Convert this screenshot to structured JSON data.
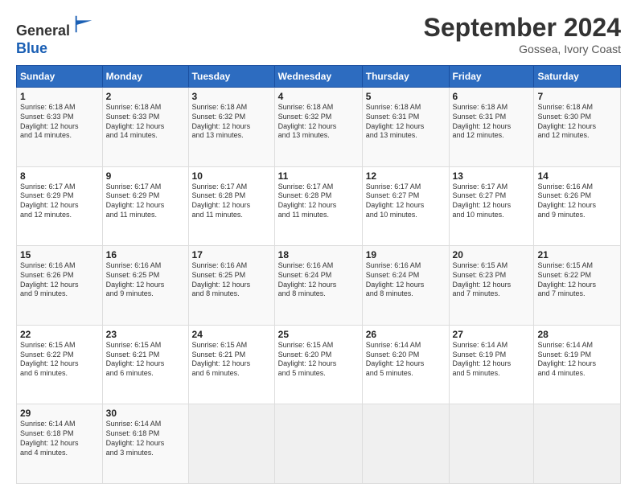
{
  "logo": {
    "general": "General",
    "blue": "Blue"
  },
  "header": {
    "month": "September 2024",
    "location": "Gossea, Ivory Coast"
  },
  "days_of_week": [
    "Sunday",
    "Monday",
    "Tuesday",
    "Wednesday",
    "Thursday",
    "Friday",
    "Saturday"
  ],
  "weeks": [
    [
      {
        "day": 1,
        "sunrise": "6:18 AM",
        "sunset": "6:33 PM",
        "daylight": "12 hours and 14 minutes."
      },
      {
        "day": 2,
        "sunrise": "6:18 AM",
        "sunset": "6:33 PM",
        "daylight": "12 hours and 14 minutes."
      },
      {
        "day": 3,
        "sunrise": "6:18 AM",
        "sunset": "6:32 PM",
        "daylight": "12 hours and 13 minutes."
      },
      {
        "day": 4,
        "sunrise": "6:18 AM",
        "sunset": "6:32 PM",
        "daylight": "12 hours and 13 minutes."
      },
      {
        "day": 5,
        "sunrise": "6:18 AM",
        "sunset": "6:31 PM",
        "daylight": "12 hours and 13 minutes."
      },
      {
        "day": 6,
        "sunrise": "6:18 AM",
        "sunset": "6:31 PM",
        "daylight": "12 hours and 12 minutes."
      },
      {
        "day": 7,
        "sunrise": "6:18 AM",
        "sunset": "6:30 PM",
        "daylight": "12 hours and 12 minutes."
      }
    ],
    [
      {
        "day": 8,
        "sunrise": "6:17 AM",
        "sunset": "6:29 PM",
        "daylight": "12 hours and 12 minutes."
      },
      {
        "day": 9,
        "sunrise": "6:17 AM",
        "sunset": "6:29 PM",
        "daylight": "12 hours and 11 minutes."
      },
      {
        "day": 10,
        "sunrise": "6:17 AM",
        "sunset": "6:28 PM",
        "daylight": "12 hours and 11 minutes."
      },
      {
        "day": 11,
        "sunrise": "6:17 AM",
        "sunset": "6:28 PM",
        "daylight": "12 hours and 11 minutes."
      },
      {
        "day": 12,
        "sunrise": "6:17 AM",
        "sunset": "6:27 PM",
        "daylight": "12 hours and 10 minutes."
      },
      {
        "day": 13,
        "sunrise": "6:17 AM",
        "sunset": "6:27 PM",
        "daylight": "12 hours and 10 minutes."
      },
      {
        "day": 14,
        "sunrise": "6:16 AM",
        "sunset": "6:26 PM",
        "daylight": "12 hours and 9 minutes."
      }
    ],
    [
      {
        "day": 15,
        "sunrise": "6:16 AM",
        "sunset": "6:26 PM",
        "daylight": "12 hours and 9 minutes."
      },
      {
        "day": 16,
        "sunrise": "6:16 AM",
        "sunset": "6:25 PM",
        "daylight": "12 hours and 9 minutes."
      },
      {
        "day": 17,
        "sunrise": "6:16 AM",
        "sunset": "6:25 PM",
        "daylight": "12 hours and 8 minutes."
      },
      {
        "day": 18,
        "sunrise": "6:16 AM",
        "sunset": "6:24 PM",
        "daylight": "12 hours and 8 minutes."
      },
      {
        "day": 19,
        "sunrise": "6:16 AM",
        "sunset": "6:24 PM",
        "daylight": "12 hours and 8 minutes."
      },
      {
        "day": 20,
        "sunrise": "6:15 AM",
        "sunset": "6:23 PM",
        "daylight": "12 hours and 7 minutes."
      },
      {
        "day": 21,
        "sunrise": "6:15 AM",
        "sunset": "6:22 PM",
        "daylight": "12 hours and 7 minutes."
      }
    ],
    [
      {
        "day": 22,
        "sunrise": "6:15 AM",
        "sunset": "6:22 PM",
        "daylight": "12 hours and 6 minutes."
      },
      {
        "day": 23,
        "sunrise": "6:15 AM",
        "sunset": "6:21 PM",
        "daylight": "12 hours and 6 minutes."
      },
      {
        "day": 24,
        "sunrise": "6:15 AM",
        "sunset": "6:21 PM",
        "daylight": "12 hours and 6 minutes."
      },
      {
        "day": 25,
        "sunrise": "6:15 AM",
        "sunset": "6:20 PM",
        "daylight": "12 hours and 5 minutes."
      },
      {
        "day": 26,
        "sunrise": "6:14 AM",
        "sunset": "6:20 PM",
        "daylight": "12 hours and 5 minutes."
      },
      {
        "day": 27,
        "sunrise": "6:14 AM",
        "sunset": "6:19 PM",
        "daylight": "12 hours and 5 minutes."
      },
      {
        "day": 28,
        "sunrise": "6:14 AM",
        "sunset": "6:19 PM",
        "daylight": "12 hours and 4 minutes."
      }
    ],
    [
      {
        "day": 29,
        "sunrise": "6:14 AM",
        "sunset": "6:18 PM",
        "daylight": "12 hours and 4 minutes."
      },
      {
        "day": 30,
        "sunrise": "6:14 AM",
        "sunset": "6:18 PM",
        "daylight": "12 hours and 3 minutes."
      },
      null,
      null,
      null,
      null,
      null
    ]
  ]
}
